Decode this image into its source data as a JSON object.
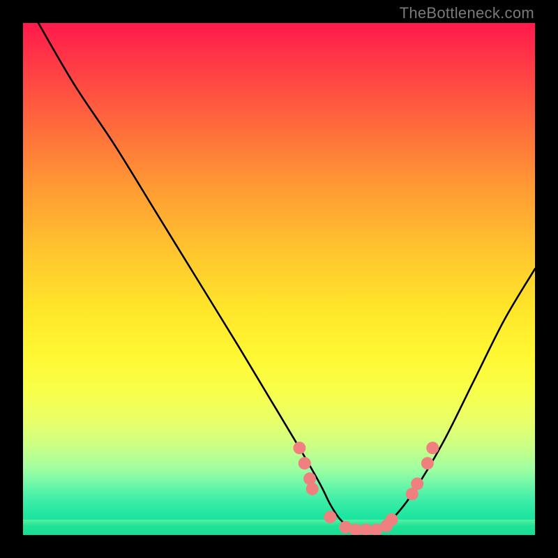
{
  "watermark": "TheBottleneck.com",
  "chart_data": {
    "type": "line",
    "title": "",
    "xlabel": "",
    "ylabel": "",
    "xlim": [
      0,
      100
    ],
    "ylim": [
      0,
      100
    ],
    "grid": false,
    "legend": false,
    "series": [
      {
        "name": "bottleneck-curve",
        "x": [
          3,
          10,
          18,
          26,
          34,
          42,
          48,
          54,
          58,
          60,
          62,
          64,
          66,
          68,
          70,
          72,
          76,
          82,
          88,
          94,
          100
        ],
        "y": [
          100,
          88,
          76,
          63,
          50,
          37,
          27,
          17,
          10,
          6,
          3,
          1.5,
          1,
          1,
          1.5,
          3,
          8,
          18,
          30,
          42,
          52
        ]
      }
    ],
    "markers": {
      "name": "highlight-points",
      "color": "#f08080",
      "radius_px": 9,
      "x": [
        54,
        55,
        56,
        56.5,
        60,
        63,
        65,
        67,
        69,
        71,
        72,
        76,
        77,
        79,
        80
      ],
      "y": [
        17,
        14,
        11,
        9,
        3.5,
        1.5,
        1,
        1,
        1,
        1.8,
        3,
        8,
        10,
        14,
        17
      ]
    },
    "background": {
      "type": "vertical-gradient",
      "stops": [
        {
          "pos": 0.0,
          "color": "#ff1a4b"
        },
        {
          "pos": 0.5,
          "color": "#ffe62a"
        },
        {
          "pos": 0.83,
          "color": "#c8ff88"
        },
        {
          "pos": 1.0,
          "color": "#18dc92"
        }
      ]
    }
  }
}
